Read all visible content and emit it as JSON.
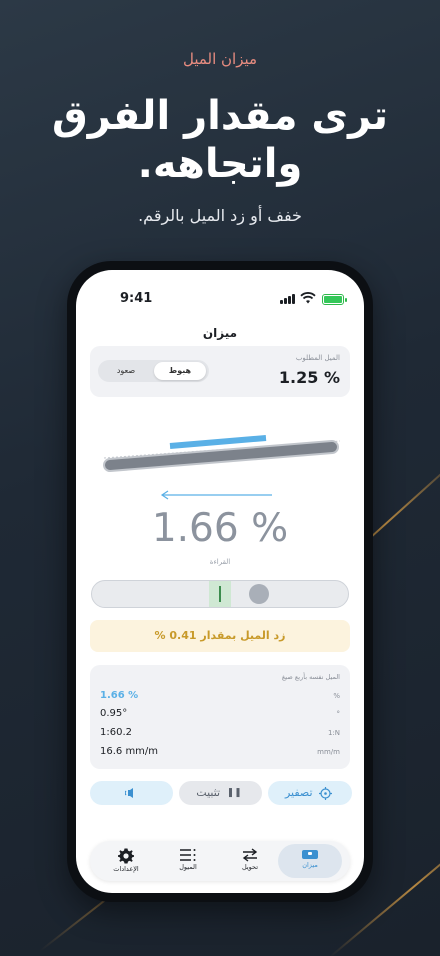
{
  "hero": {
    "eyebrow": "ميزان الميل",
    "title_line1": "ترى مقدار الفرق",
    "title_line2": "واتجاهه.",
    "subtitle": "خفف أو زد الميل بالرقم."
  },
  "status": {
    "time": "9:41"
  },
  "screen": {
    "title": "ميزان",
    "target": {
      "label": "الميل المطلوب",
      "value": "1.25 %"
    },
    "direction_toggle": {
      "options": [
        "هبوط",
        "صعود"
      ],
      "selected": "هبوط"
    },
    "reading": {
      "value": "1.66 %",
      "label": "القراءة"
    },
    "hint": "زد الميل بمقدار 0.41 %",
    "stats": {
      "title": "الميل نفسه بأربع صيغ",
      "rows": [
        {
          "value": "1.66 %",
          "unit": "%"
        },
        {
          "value": "0.95°",
          "unit": "°"
        },
        {
          "value": "1:60.2",
          "unit": "1:N"
        },
        {
          "value": "16.6 mm/m",
          "unit": "mm/m"
        }
      ]
    },
    "actions": {
      "hold": "تثبيت",
      "zero": "تصفير"
    },
    "tabs": [
      {
        "label": "ميزان",
        "icon": "level-icon",
        "active": true
      },
      {
        "label": "تحويل",
        "icon": "swap-icon",
        "active": false
      },
      {
        "label": "الميول",
        "icon": "list-icon",
        "active": false
      },
      {
        "label": "الإعدادات",
        "icon": "gear-icon",
        "active": false
      }
    ]
  },
  "colors": {
    "accent": "#3b90d0",
    "reading": "#8c939e",
    "hint_text": "#c89a2a",
    "eyebrow": "#e88c80"
  }
}
